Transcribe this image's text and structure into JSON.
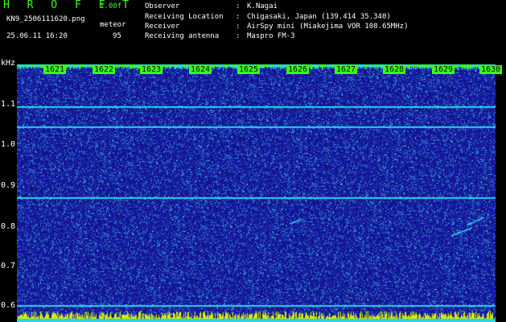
{
  "header": {
    "app_title": "H R O F F T",
    "version": "1.00f",
    "file_name": "KN9_2506111620.png",
    "meteor_label": "meteor",
    "datetime": "25.06.11 16:20",
    "meteor_count": "95"
  },
  "info": [
    {
      "key": "Observer",
      "value": "K.Nagai"
    },
    {
      "key": "Receiving Location",
      "value": "Chigasaki, Japan (139.414 35.340)"
    },
    {
      "key": "Receiver",
      "value": "AirSpy mini (Miakejima VOR 108.65MHz)"
    },
    {
      "key": "Receiving antenna",
      "value": "Maspro FM-3"
    }
  ],
  "colors": {
    "green": "#39ff14",
    "background": "#000000",
    "noise": "#1c1cb4",
    "signal": "#2ad3e6",
    "noise_floor": "#d8e800"
  },
  "chart_data": {
    "type": "heatmap",
    "ylabel": "kHz",
    "yticks": [
      "1.1",
      "1.0",
      "0.9",
      "0.8",
      "0.7",
      "0.6"
    ],
    "ylim": [
      0.58,
      1.2
    ],
    "xticks": [
      "1621",
      "1622",
      "1623",
      "1624",
      "1625",
      "1626",
      "1627",
      "1628",
      "1629",
      "1630"
    ],
    "carrier_lines_khz": [
      1.1,
      1.05,
      0.88,
      0.62
    ]
  }
}
